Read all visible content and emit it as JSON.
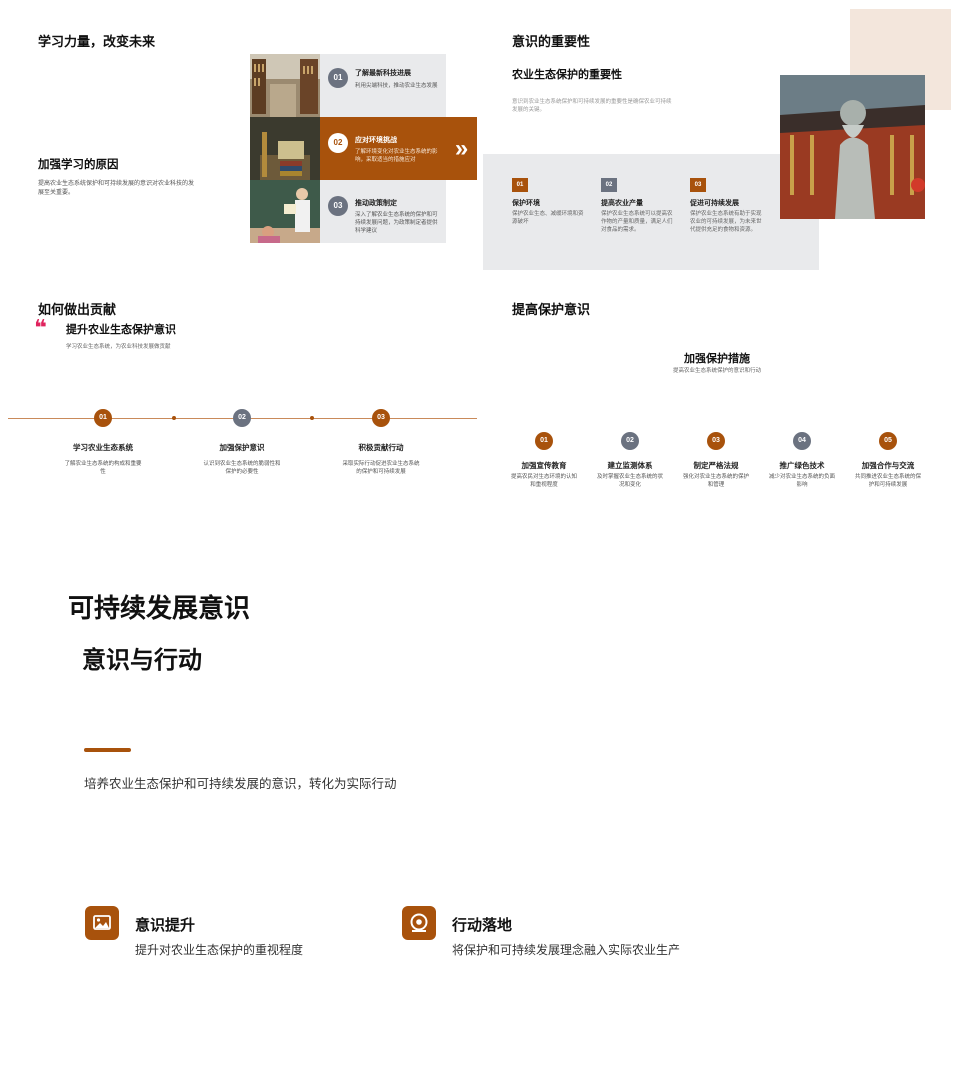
{
  "slide1": {
    "title": "学习力量，改变未来",
    "heading": "加强学习的原因",
    "desc": "提高农业生态系统保护和可持续发展的意识对农业科技的发展至关重要。",
    "cards": [
      {
        "num": "01",
        "title": "了解最新科技进展",
        "desc": "利用尖端科技，推动农业生态发展"
      },
      {
        "num": "02",
        "title": "应对环境挑战",
        "desc": "了解环境变化对农业生态系统的影响，采取适当的措施应对"
      },
      {
        "num": "03",
        "title": "推动政策制定",
        "desc": "深入了解农业生态系统的保护和可持续发展问题，为政策制定者提供科学建议"
      }
    ],
    "arrow": "»"
  },
  "slide2": {
    "title": "意识的重要性",
    "subtitle": "农业生态保护的重要性",
    "desc": "意识到农业生态系统保护和可持续发展的重要性是确保农业可持续发展的关键。",
    "items": [
      {
        "num": "01",
        "title": "保护环境",
        "desc": "保护农业生态、减缓环境和资源破坏",
        "color": "#a8520c"
      },
      {
        "num": "02",
        "title": "提高农业产量",
        "desc": "保护农业生态系统可以提高农作物的产量和质量，满足人们对食品的需求。",
        "color": "#6b7280"
      },
      {
        "num": "03",
        "title": "促进可持续发展",
        "desc": "保护农业生态系统有助于实现农业的可持续发展，为未来世代提供充足的食物和资源。",
        "color": "#a8520c"
      }
    ]
  },
  "slide3": {
    "title": "如何做出贡献",
    "quote_mark": "❝",
    "subtitle": "提升农业生态保护意识",
    "desc": "学习农业生态系统，为农业科技发展做贡献",
    "steps": [
      {
        "num": "01",
        "title": "学习农业生态系统",
        "desc": "了解农业生态系统的构成和重要性",
        "color": "#a8520c"
      },
      {
        "num": "02",
        "title": "加强保护意识",
        "desc": "认识到农业生态系统的脆弱性和保护的必要性",
        "color": "#6b7280"
      },
      {
        "num": "03",
        "title": "积极贡献行动",
        "desc": "采取实际行动促进农业生态系统的保护和可持续发展",
        "color": "#a8520c"
      }
    ]
  },
  "slide4": {
    "title": "提高保护意识",
    "subtitle": "加强保护措施",
    "desc": "提高农业生态系统保护的意识和行动",
    "steps": [
      {
        "num": "01",
        "title": "加强宣传教育",
        "desc": "提高农民对生态环境的认知和重视程度",
        "color": "#a8520c"
      },
      {
        "num": "02",
        "title": "建立监测体系",
        "desc": "及时掌握农业生态系统的状况和变化",
        "color": "#6b7280"
      },
      {
        "num": "03",
        "title": "制定严格法规",
        "desc": "强化对农业生态系统的保护和管理",
        "color": "#a8520c"
      },
      {
        "num": "04",
        "title": "推广绿色技术",
        "desc": "减少对农业生态系统的负面影响",
        "color": "#6b7280"
      },
      {
        "num": "05",
        "title": "加强合作与交流",
        "desc": "共同推进农业生态系统的保护和可持续发展",
        "color": "#a8520c"
      }
    ]
  },
  "slide5": {
    "title": "可持续发展意识",
    "subtitle": "意识与行动",
    "desc": "培养农业生态保护和可持续发展的意识，转化为实际行动",
    "features": [
      {
        "icon": "image-icon",
        "title": "意识提升",
        "desc": "提升对农业生态保护的重视程度"
      },
      {
        "icon": "target-icon",
        "title": "行动落地",
        "desc": "将保护和可持续发展理念融入实际农业生产"
      }
    ]
  },
  "colors": {
    "accent": "#a8520c",
    "grey": "#6b7280",
    "panel": "#e9eaec",
    "quote": "#e0245e",
    "beige": "#f3e6dc"
  }
}
